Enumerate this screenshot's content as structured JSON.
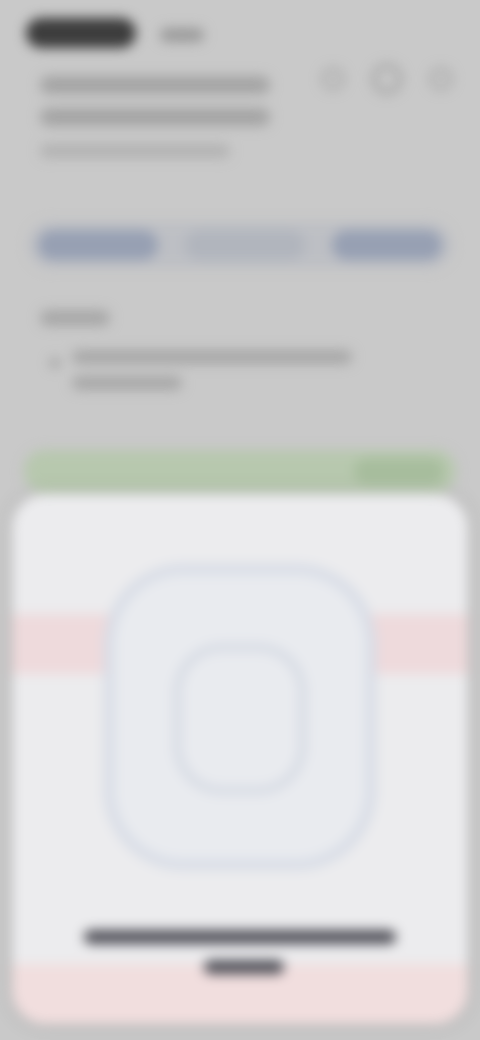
{
  "screen": {
    "note": "",
    "colors": {
      "background": "#c9c9c9",
      "tab_active": "#97a0b3",
      "banner_green": "#b7c8ae",
      "card": "#ececee",
      "card_accent_pink": "#eedadc",
      "caption_text": "#4f4f57"
    }
  },
  "status_bar": {
    "time": ""
  },
  "header": {
    "title": "",
    "subtitle": "",
    "icons": [
      "share-icon",
      "profile-icon",
      "more-icon"
    ]
  },
  "tabs": [
    {
      "label": "",
      "active": true
    },
    {
      "label": "",
      "active": false
    },
    {
      "label": "",
      "active": false
    }
  ],
  "section": {
    "label": "",
    "items": [
      {
        "text": ""
      }
    ]
  },
  "banner": {
    "text": "",
    "action": ""
  },
  "card": {
    "illustration": "phone-outline-illustration",
    "caption": ""
  }
}
